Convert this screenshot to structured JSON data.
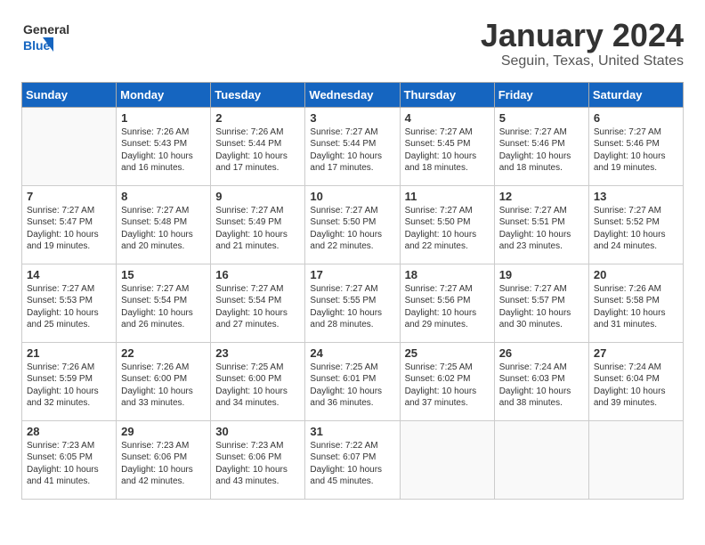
{
  "header": {
    "logo_general": "General",
    "logo_blue": "Blue",
    "title": "January 2024",
    "subtitle": "Seguin, Texas, United States"
  },
  "calendar": {
    "days_of_week": [
      "Sunday",
      "Monday",
      "Tuesday",
      "Wednesday",
      "Thursday",
      "Friday",
      "Saturday"
    ],
    "weeks": [
      [
        {
          "day": "",
          "info": ""
        },
        {
          "day": "1",
          "info": "Sunrise: 7:26 AM\nSunset: 5:43 PM\nDaylight: 10 hours\nand 16 minutes."
        },
        {
          "day": "2",
          "info": "Sunrise: 7:26 AM\nSunset: 5:44 PM\nDaylight: 10 hours\nand 17 minutes."
        },
        {
          "day": "3",
          "info": "Sunrise: 7:27 AM\nSunset: 5:44 PM\nDaylight: 10 hours\nand 17 minutes."
        },
        {
          "day": "4",
          "info": "Sunrise: 7:27 AM\nSunset: 5:45 PM\nDaylight: 10 hours\nand 18 minutes."
        },
        {
          "day": "5",
          "info": "Sunrise: 7:27 AM\nSunset: 5:46 PM\nDaylight: 10 hours\nand 18 minutes."
        },
        {
          "day": "6",
          "info": "Sunrise: 7:27 AM\nSunset: 5:46 PM\nDaylight: 10 hours\nand 19 minutes."
        }
      ],
      [
        {
          "day": "7",
          "info": "Sunrise: 7:27 AM\nSunset: 5:47 PM\nDaylight: 10 hours\nand 19 minutes."
        },
        {
          "day": "8",
          "info": "Sunrise: 7:27 AM\nSunset: 5:48 PM\nDaylight: 10 hours\nand 20 minutes."
        },
        {
          "day": "9",
          "info": "Sunrise: 7:27 AM\nSunset: 5:49 PM\nDaylight: 10 hours\nand 21 minutes."
        },
        {
          "day": "10",
          "info": "Sunrise: 7:27 AM\nSunset: 5:50 PM\nDaylight: 10 hours\nand 22 minutes."
        },
        {
          "day": "11",
          "info": "Sunrise: 7:27 AM\nSunset: 5:50 PM\nDaylight: 10 hours\nand 22 minutes."
        },
        {
          "day": "12",
          "info": "Sunrise: 7:27 AM\nSunset: 5:51 PM\nDaylight: 10 hours\nand 23 minutes."
        },
        {
          "day": "13",
          "info": "Sunrise: 7:27 AM\nSunset: 5:52 PM\nDaylight: 10 hours\nand 24 minutes."
        }
      ],
      [
        {
          "day": "14",
          "info": "Sunrise: 7:27 AM\nSunset: 5:53 PM\nDaylight: 10 hours\nand 25 minutes."
        },
        {
          "day": "15",
          "info": "Sunrise: 7:27 AM\nSunset: 5:54 PM\nDaylight: 10 hours\nand 26 minutes."
        },
        {
          "day": "16",
          "info": "Sunrise: 7:27 AM\nSunset: 5:54 PM\nDaylight: 10 hours\nand 27 minutes."
        },
        {
          "day": "17",
          "info": "Sunrise: 7:27 AM\nSunset: 5:55 PM\nDaylight: 10 hours\nand 28 minutes."
        },
        {
          "day": "18",
          "info": "Sunrise: 7:27 AM\nSunset: 5:56 PM\nDaylight: 10 hours\nand 29 minutes."
        },
        {
          "day": "19",
          "info": "Sunrise: 7:27 AM\nSunset: 5:57 PM\nDaylight: 10 hours\nand 30 minutes."
        },
        {
          "day": "20",
          "info": "Sunrise: 7:26 AM\nSunset: 5:58 PM\nDaylight: 10 hours\nand 31 minutes."
        }
      ],
      [
        {
          "day": "21",
          "info": "Sunrise: 7:26 AM\nSunset: 5:59 PM\nDaylight: 10 hours\nand 32 minutes."
        },
        {
          "day": "22",
          "info": "Sunrise: 7:26 AM\nSunset: 6:00 PM\nDaylight: 10 hours\nand 33 minutes."
        },
        {
          "day": "23",
          "info": "Sunrise: 7:25 AM\nSunset: 6:00 PM\nDaylight: 10 hours\nand 34 minutes."
        },
        {
          "day": "24",
          "info": "Sunrise: 7:25 AM\nSunset: 6:01 PM\nDaylight: 10 hours\nand 36 minutes."
        },
        {
          "day": "25",
          "info": "Sunrise: 7:25 AM\nSunset: 6:02 PM\nDaylight: 10 hours\nand 37 minutes."
        },
        {
          "day": "26",
          "info": "Sunrise: 7:24 AM\nSunset: 6:03 PM\nDaylight: 10 hours\nand 38 minutes."
        },
        {
          "day": "27",
          "info": "Sunrise: 7:24 AM\nSunset: 6:04 PM\nDaylight: 10 hours\nand 39 minutes."
        }
      ],
      [
        {
          "day": "28",
          "info": "Sunrise: 7:23 AM\nSunset: 6:05 PM\nDaylight: 10 hours\nand 41 minutes."
        },
        {
          "day": "29",
          "info": "Sunrise: 7:23 AM\nSunset: 6:06 PM\nDaylight: 10 hours\nand 42 minutes."
        },
        {
          "day": "30",
          "info": "Sunrise: 7:23 AM\nSunset: 6:06 PM\nDaylight: 10 hours\nand 43 minutes."
        },
        {
          "day": "31",
          "info": "Sunrise: 7:22 AM\nSunset: 6:07 PM\nDaylight: 10 hours\nand 45 minutes."
        },
        {
          "day": "",
          "info": ""
        },
        {
          "day": "",
          "info": ""
        },
        {
          "day": "",
          "info": ""
        }
      ]
    ]
  }
}
